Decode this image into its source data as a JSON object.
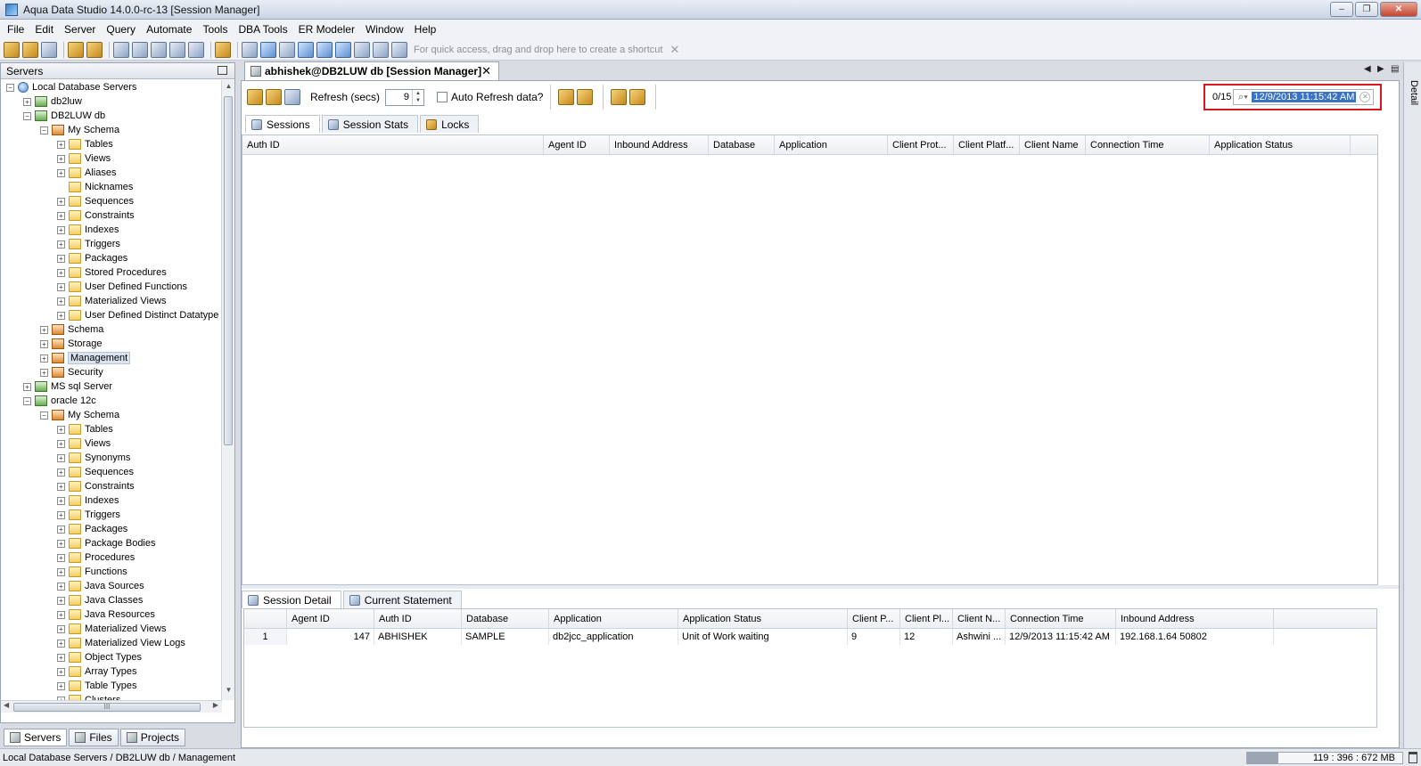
{
  "window": {
    "title": "Aqua Data Studio 14.0.0-rc-13 [Session Manager]",
    "controls": [
      "‒",
      "❐",
      "✕"
    ]
  },
  "menu": [
    "File",
    "Edit",
    "Server",
    "Query",
    "Automate",
    "Tools",
    "DBA Tools",
    "ER Modeler",
    "Window",
    "Help"
  ],
  "toolbar": {
    "shortcut_hint": "For quick access, drag and drop here to create a shortcut",
    "hint_close": "✕"
  },
  "servers_panel": {
    "title": "Servers",
    "tree": [
      {
        "label": "Local Database Servers",
        "depth": 0,
        "exp": "-",
        "icon": "globe"
      },
      {
        "label": "db2luw",
        "depth": 1,
        "exp": "+",
        "icon": "server"
      },
      {
        "label": "DB2LUW db",
        "depth": 1,
        "exp": "-",
        "icon": "server"
      },
      {
        "label": "My Schema",
        "depth": 2,
        "exp": "-",
        "icon": "schema"
      },
      {
        "label": "Tables",
        "depth": 3,
        "exp": "+",
        "icon": "folder"
      },
      {
        "label": "Views",
        "depth": 3,
        "exp": "+",
        "icon": "folder"
      },
      {
        "label": "Aliases",
        "depth": 3,
        "exp": "+",
        "icon": "folder"
      },
      {
        "label": "Nicknames",
        "depth": 3,
        "exp": "",
        "icon": "folder"
      },
      {
        "label": "Sequences",
        "depth": 3,
        "exp": "+",
        "icon": "folder"
      },
      {
        "label": "Constraints",
        "depth": 3,
        "exp": "+",
        "icon": "folder"
      },
      {
        "label": "Indexes",
        "depth": 3,
        "exp": "+",
        "icon": "folder"
      },
      {
        "label": "Triggers",
        "depth": 3,
        "exp": "+",
        "icon": "folder"
      },
      {
        "label": "Packages",
        "depth": 3,
        "exp": "+",
        "icon": "folder"
      },
      {
        "label": "Stored Procedures",
        "depth": 3,
        "exp": "+",
        "icon": "folder"
      },
      {
        "label": "User Defined Functions",
        "depth": 3,
        "exp": "+",
        "icon": "folder"
      },
      {
        "label": "Materialized Views",
        "depth": 3,
        "exp": "+",
        "icon": "folder"
      },
      {
        "label": "User Defined Distinct Datatype",
        "depth": 3,
        "exp": "+",
        "icon": "folder"
      },
      {
        "label": "Schema",
        "depth": 2,
        "exp": "+",
        "icon": "schema"
      },
      {
        "label": "Storage",
        "depth": 2,
        "exp": "+",
        "icon": "schema"
      },
      {
        "label": "Management",
        "depth": 2,
        "exp": "+",
        "icon": "schema",
        "selected": true
      },
      {
        "label": "Security",
        "depth": 2,
        "exp": "+",
        "icon": "schema"
      },
      {
        "label": "MS sql Server",
        "depth": 1,
        "exp": "+",
        "icon": "server"
      },
      {
        "label": "oracle 12c",
        "depth": 1,
        "exp": "-",
        "icon": "server"
      },
      {
        "label": "My Schema",
        "depth": 2,
        "exp": "-",
        "icon": "schema"
      },
      {
        "label": "Tables",
        "depth": 3,
        "exp": "+",
        "icon": "folder"
      },
      {
        "label": "Views",
        "depth": 3,
        "exp": "+",
        "icon": "folder"
      },
      {
        "label": "Synonyms",
        "depth": 3,
        "exp": "+",
        "icon": "folder"
      },
      {
        "label": "Sequences",
        "depth": 3,
        "exp": "+",
        "icon": "folder"
      },
      {
        "label": "Constraints",
        "depth": 3,
        "exp": "+",
        "icon": "folder"
      },
      {
        "label": "Indexes",
        "depth": 3,
        "exp": "+",
        "icon": "folder"
      },
      {
        "label": "Triggers",
        "depth": 3,
        "exp": "+",
        "icon": "folder"
      },
      {
        "label": "Packages",
        "depth": 3,
        "exp": "+",
        "icon": "folder"
      },
      {
        "label": "Package Bodies",
        "depth": 3,
        "exp": "+",
        "icon": "folder"
      },
      {
        "label": "Procedures",
        "depth": 3,
        "exp": "+",
        "icon": "folder"
      },
      {
        "label": "Functions",
        "depth": 3,
        "exp": "+",
        "icon": "folder"
      },
      {
        "label": "Java Sources",
        "depth": 3,
        "exp": "+",
        "icon": "folder"
      },
      {
        "label": "Java Classes",
        "depth": 3,
        "exp": "+",
        "icon": "folder"
      },
      {
        "label": "Java Resources",
        "depth": 3,
        "exp": "+",
        "icon": "folder"
      },
      {
        "label": "Materialized Views",
        "depth": 3,
        "exp": "+",
        "icon": "folder"
      },
      {
        "label": "Materialized View Logs",
        "depth": 3,
        "exp": "+",
        "icon": "folder"
      },
      {
        "label": "Object Types",
        "depth": 3,
        "exp": "+",
        "icon": "folder"
      },
      {
        "label": "Array Types",
        "depth": 3,
        "exp": "+",
        "icon": "folder"
      },
      {
        "label": "Table Types",
        "depth": 3,
        "exp": "+",
        "icon": "folder"
      },
      {
        "label": "Clusters",
        "depth": 3,
        "exp": "+",
        "icon": "folder"
      }
    ],
    "hscroll_grip": "III",
    "bottom_tabs": [
      "Servers",
      "Files",
      "Projects"
    ]
  },
  "editor": {
    "tab_title": "abhishek@DB2LUW db [Session Manager]",
    "tab_close": "✕",
    "detail_label": "Detail",
    "refresh_label": "Refresh (secs)",
    "refresh_value": "9",
    "auto_refresh_label": "Auto Refresh data?",
    "search": {
      "count": "0/15",
      "value": "12/9/2013 11:15:42 AM"
    },
    "tabs": [
      "Sessions",
      "Session Stats",
      "Locks"
    ],
    "top_columns": [
      "Auth ID",
      "Agent ID",
      "Inbound Address",
      "Database",
      "Application",
      "Client Prot...",
      "Client Platf...",
      "Client Name",
      "Connection Time",
      "Application Status"
    ],
    "bottom_tabs": [
      "Session Detail",
      "Current Statement"
    ],
    "bottom_columns": [
      "Agent ID",
      "Auth ID",
      "Database",
      "Application",
      "Application Status",
      "Client P...",
      "Client Pl...",
      "Client N...",
      "Connection Time",
      "Inbound Address"
    ],
    "bottom_rows": [
      {
        "num": "1",
        "cells": [
          "147",
          "ABHISHEK",
          "SAMPLE",
          "db2jcc_application",
          "Unit of Work waiting",
          "9",
          "12",
          "Ashwini  ...",
          "12/9/2013 11:15:42 AM",
          "192.168.1.64 50802"
        ]
      }
    ]
  },
  "status": {
    "path": "Local Database Servers / DB2LUW db / Management",
    "memory": "119 : 396 : 672 MB"
  },
  "colors": {
    "highlight_border": "#d9171e",
    "selection": "#3a72c4"
  }
}
